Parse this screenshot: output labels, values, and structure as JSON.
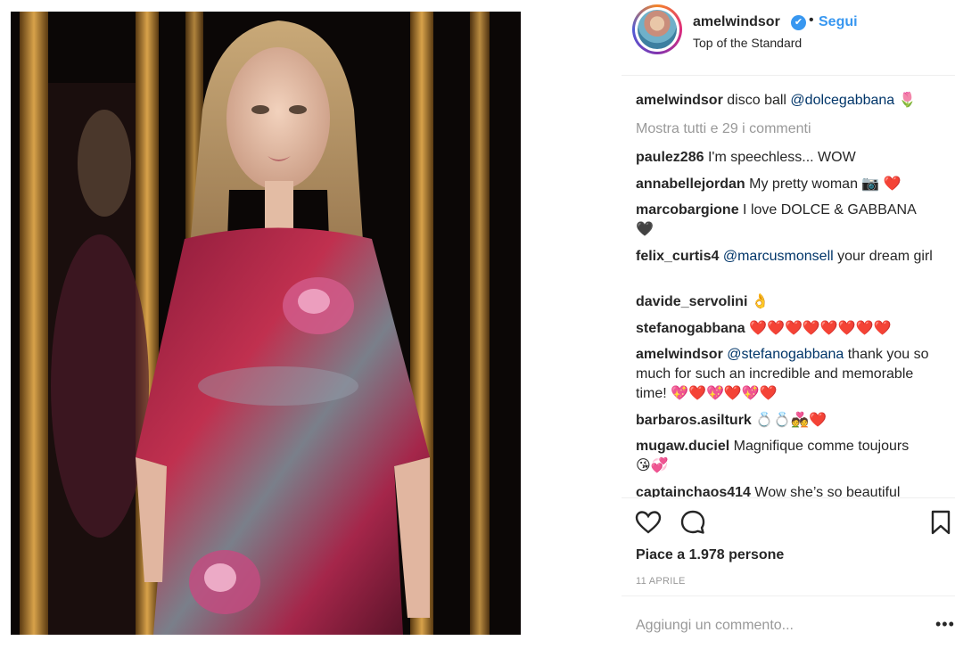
{
  "post": {
    "username": "amelwindsor",
    "verified_mark": "✔",
    "dot": "•",
    "follow_label": "Segui",
    "location": "Top of the Standard"
  },
  "caption": {
    "username": "amelwindsor",
    "text": "disco ball",
    "mention": "@dolcegabbana",
    "emoji": "🌷"
  },
  "show_all": "Mostra tutti e 29 i commenti",
  "comments": [
    {
      "user": "paulez286",
      "text": "I'm speechless... WOW"
    },
    {
      "user": "annabellejordan",
      "text": "My pretty woman",
      "emoji": "📷 ❤️"
    },
    {
      "user": "marcobargione",
      "text": "I love DOLCE & GABBANA",
      "emoji": "🖤"
    },
    {
      "user": "felix_curtis4",
      "mention": "@marcusmonsell",
      "text": "your dream girl"
    },
    {
      "user": "davide_servolini",
      "emoji": "👌"
    },
    {
      "user": "stefanogabbana",
      "emoji": "❤️❤️❤️❤️❤️❤️❤️❤️"
    },
    {
      "user": "amelwindsor",
      "mention": "@stefanogabbana",
      "text": "thank you so much for such an incredible and memorable time!",
      "emoji": "💖❤️💖❤️💖❤️"
    },
    {
      "user": "barbaros.asilturk",
      "emoji": "💍💍💑❤️"
    },
    {
      "user": "mugaw.duciel",
      "text": "Magnifique comme toujours",
      "emoji": "😘💞"
    },
    {
      "user": "captainchaos414",
      "text": "Wow she’s so beautiful"
    }
  ],
  "actions": {
    "like_icon": "heart-outline-icon",
    "comment_icon": "speech-bubble-icon",
    "save_icon": "bookmark-icon"
  },
  "likes_text": "Piace a 1.978 persone",
  "date": "11 APRILE",
  "add_comment_placeholder": "Aggiungi un commento...",
  "options": "•••"
}
